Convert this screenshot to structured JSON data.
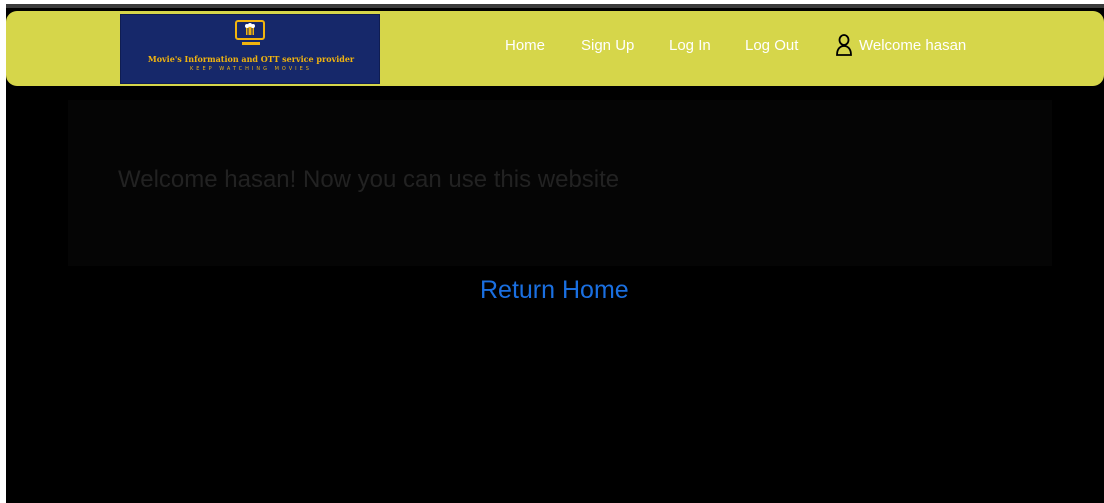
{
  "nav": {
    "logo_title": "Movie's Information and OTT service provider",
    "logo_tagline": "KEEP WATCHING MOVIES",
    "links": [
      {
        "label": "Home"
      },
      {
        "label": "Sign Up"
      },
      {
        "label": "Log In"
      },
      {
        "label": "Log Out"
      }
    ],
    "user_label": "Welcome hasan",
    "user_icon": "user-outline-icon",
    "logo_icon": "tv-popcorn-icon"
  },
  "main": {
    "welcome_message": "Welcome hasan! Now you can use this website",
    "return_link": "Return Home"
  },
  "colors": {
    "navbar_bg": "#d6d64a",
    "logo_bg": "#16286a",
    "logo_accent": "#f1b40f",
    "page_bg": "#000000",
    "link_blue": "#1a6fe0"
  }
}
